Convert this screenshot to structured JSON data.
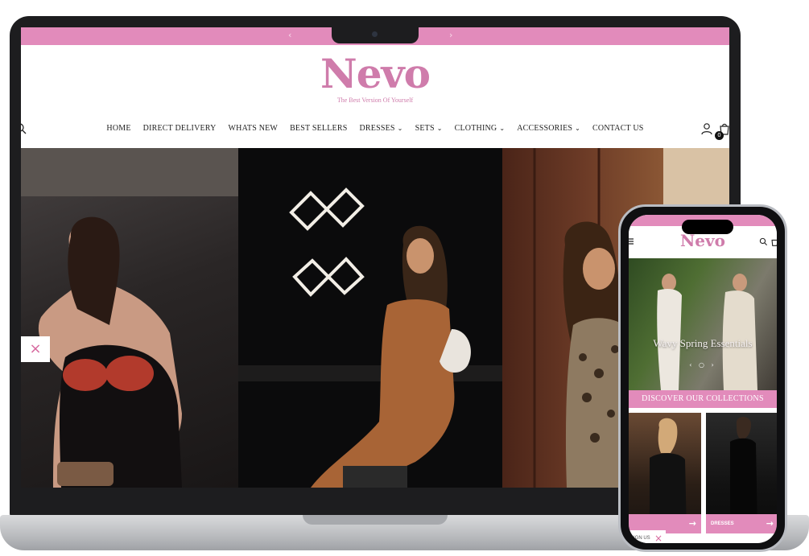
{
  "site": {
    "brand": "Nevo",
    "tagline": "The Best Version Of Yourself",
    "accent_color": "#e28bbb",
    "logo_color": "#cf7cab"
  },
  "announcement": {
    "prev_icon": "chevron-left-icon",
    "next_icon": "chevron-right-icon"
  },
  "nav": {
    "items": [
      {
        "label": "HOME",
        "dropdown": false
      },
      {
        "label": "DIRECT DELIVERY",
        "dropdown": false
      },
      {
        "label": "WHATS NEW",
        "dropdown": false
      },
      {
        "label": "BEST SELLERS",
        "dropdown": false
      },
      {
        "label": "DRESSES",
        "dropdown": true
      },
      {
        "label": "SETS",
        "dropdown": true
      },
      {
        "label": "CLOTHING",
        "dropdown": true
      },
      {
        "label": "ACCESSORIES",
        "dropdown": true
      },
      {
        "label": "CONTACT US",
        "dropdown": false
      }
    ],
    "account_icon": "user-icon",
    "cart_icon": "shopping-bag-icon",
    "search_icon": "search-icon",
    "cart_count": "0"
  },
  "hero": {
    "close_glyph": "×"
  },
  "mobile": {
    "brand": "Nevo",
    "hero_text": "Wavy Spring Essentials",
    "discover_label": "DISCOVER OUR COLLECTIONS",
    "cards": [
      {
        "label": "",
        "arrow": "→"
      },
      {
        "label": "DRESSES",
        "arrow": "→"
      }
    ],
    "close_label": "SIGN US",
    "close_glyph": "×"
  }
}
